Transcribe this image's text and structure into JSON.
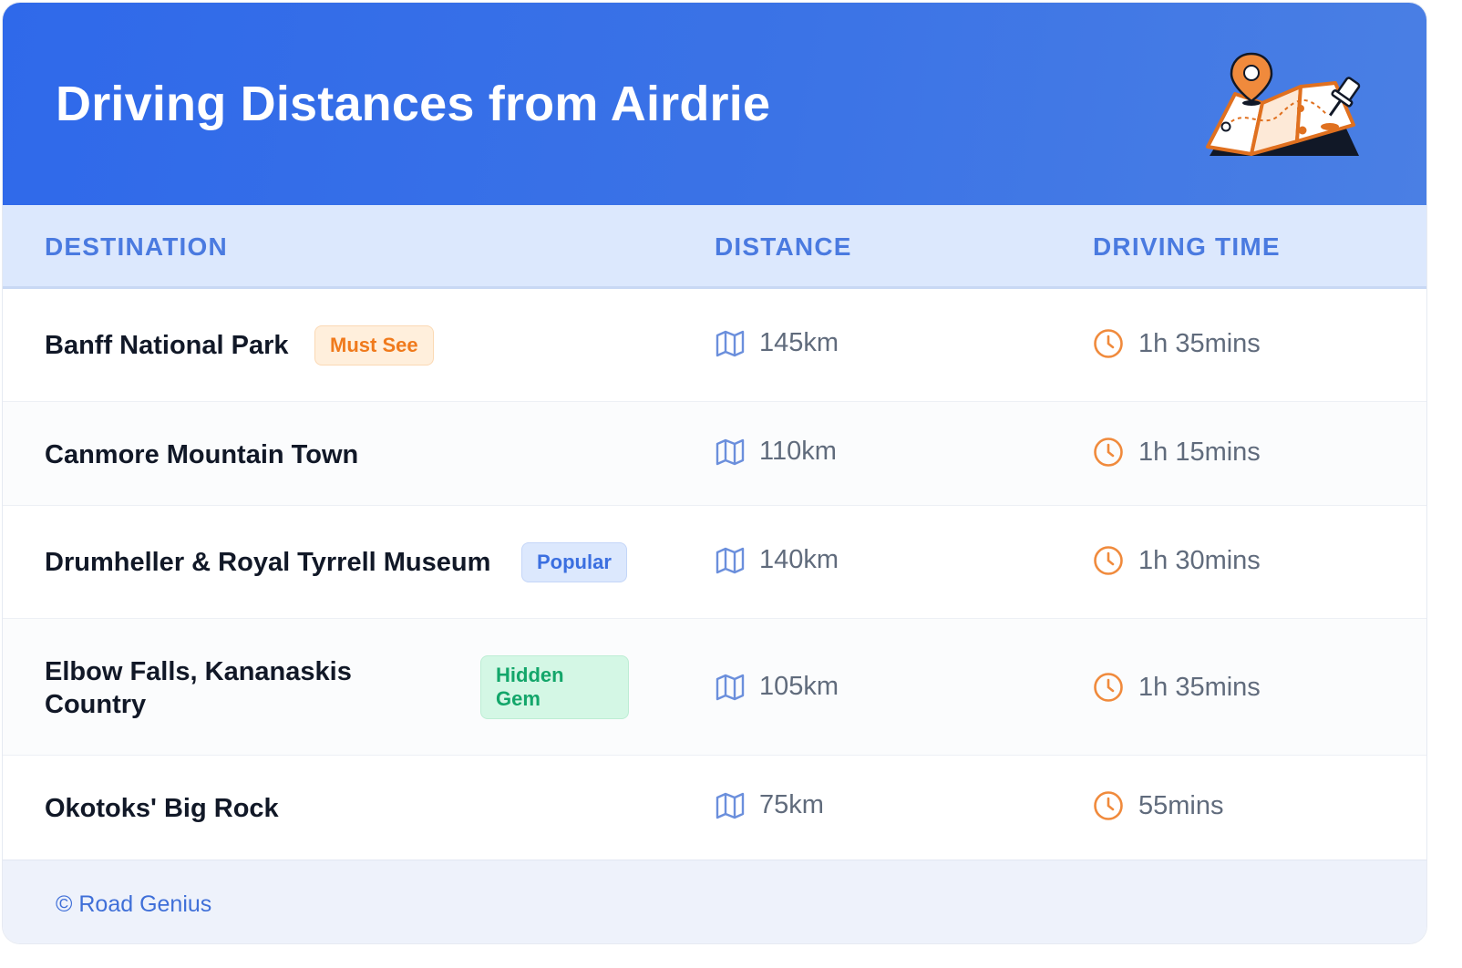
{
  "header": {
    "title": "Driving Distances from Airdrie",
    "illustration_icon": "folded-map-with-location-pin-icon"
  },
  "columns": {
    "destination": "DESTINATION",
    "distance": "DISTANCE",
    "driving_time": "DRIVING TIME"
  },
  "rows": [
    {
      "destination": "Banff National Park",
      "badge": "Must See",
      "badge_color": "#f07a1c",
      "distance": "145km",
      "time": "1h 35mins"
    },
    {
      "destination": "Canmore Mountain Town",
      "badge": null,
      "distance": "110km",
      "time": "1h 15mins"
    },
    {
      "destination": "Drumheller & Royal Tyrrell Museum",
      "badge": "Popular",
      "badge_color": "#3b6fe0",
      "distance": "140km",
      "time": "1h 30mins"
    },
    {
      "destination": "Elbow Falls, Kananaskis Country",
      "badge": "Hidden Gem",
      "badge_color": "#13a66a",
      "distance": "105km",
      "time": "1h 35mins"
    },
    {
      "destination": "Okotoks' Big Rock",
      "badge": null,
      "distance": "75km",
      "time": "55mins"
    }
  ],
  "footer": {
    "credit": "© Road Genius"
  },
  "colors": {
    "header_start": "#2f69ea",
    "header_end": "#4a7fe4",
    "column_header_bg": "#dce8fd",
    "column_header_text": "#4a7ae0",
    "distance_icon": "#6b8fdc",
    "time_icon": "#f08a3c"
  }
}
